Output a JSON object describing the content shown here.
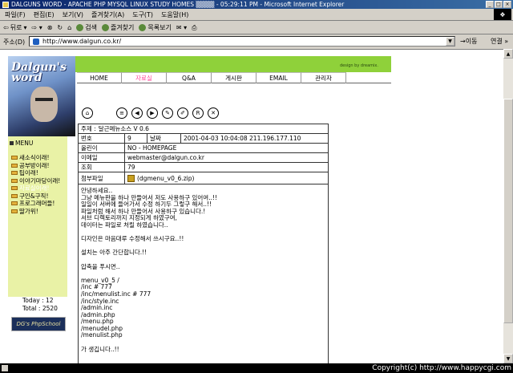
{
  "window": {
    "title": "DALGUNS WORD - APACHE PHP MYSQL LINUX STUDY HOMES ▒▒▒▒ - 05:29:11 PM - Microsoft Internet Explorer"
  },
  "menubar": {
    "items": [
      "파일(F)",
      "편집(E)",
      "보기(V)",
      "즐겨찾기(A)",
      "도구(T)",
      "도움말(H)"
    ]
  },
  "toolbar": {
    "back": "뒤로",
    "search": "검색",
    "favorites": "즐겨찾기",
    "history": "목록보기"
  },
  "address": {
    "label": "주소(D)",
    "url": "http://www.dalgun.co.kr/",
    "go": "이동",
    "links": "연결 »"
  },
  "site": {
    "logo_text": "Dalgun's word",
    "design_by": "design by dreamix.",
    "nav": [
      "HOME",
      "자료실",
      "Q&A",
      "게시판",
      "EMAIL",
      "관리자"
    ],
    "menu_title": "MENU",
    "menu_items": [
      "새소식이래!",
      "공부방이래!",
      "팁이래!",
      "이야기마당이래!",
      "자료실이래!",
      "구인&구직!",
      "프로그래머들!",
      "딸가위!"
    ],
    "current_menu": 4,
    "banner": "DG's PhpSchool",
    "counter": {
      "today_label": "Today",
      "today": "12",
      "total_label": "Total",
      "total": "2520"
    }
  },
  "post": {
    "subject_label": "주제 :",
    "subject": "달근메뉴소스 V 0.6",
    "number_label": "번호",
    "number": "9",
    "date_label": "날짜",
    "date_ip": "2001-04-03 10:04:08 211.196.177.110",
    "name_label": "올린이",
    "name": "NO - HOMEPAGE",
    "email_label": "이메일",
    "email": "webmaster@dalgun.co.kr",
    "views_label": "조회",
    "views": "79",
    "attach_label": "첨부파일",
    "attach": "(dgmenu_v0_6.zip)",
    "body": "안녕하세요..\n그냥 메뉴판을 하나 만들어서 저도 사용하구 있어여..!!\n일일이 서버에 들어가서 수정 하기두 그렇구 해서..!!\n파일처럼 해서 하나 만들어서 사용하구 있습니다.!\n서브 디렉토리까지 지정되게 하였구여,\n데이터는 파일로 처릴 하였습니다..\n\n디자인은 마음대루 수정해서 쓰시구요..!!\n\n설치는 아주 간단합니다.!!\n\n압축을 푸시면..\n\nmenu_v0_5 /\n/inc # 777\n/inc/menulist.inc # 777\n/inc/style.inc\n/admin.inc\n/admin.php\n/menu.php\n/menudel.php\n/menulist.php\n\n가 생깁니다..!!"
  },
  "status": {
    "text": "Copyright(c) http://www.happycgi.com"
  }
}
